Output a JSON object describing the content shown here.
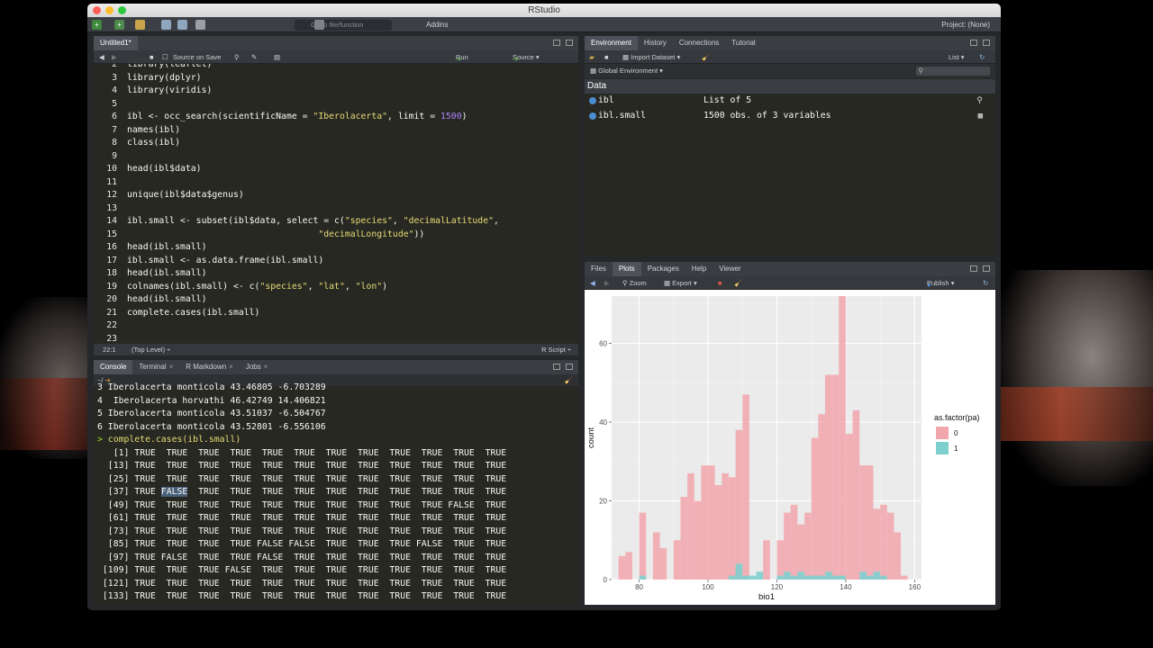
{
  "window": {
    "title": "RStudio"
  },
  "main_toolbar": {
    "goto_placeholder": "Go to file/function",
    "addins": "Addins",
    "project": "Project: (None)"
  },
  "editor": {
    "tab": "Untitled1*",
    "source_on_save": "Source on Save",
    "run": "Run",
    "source": "Source",
    "lines": [
      {
        "n": "2",
        "segs": [
          [
            "library(leaflet)",
            ""
          ]
        ]
      },
      {
        "n": "3",
        "segs": [
          [
            "library(dplyr)",
            ""
          ]
        ]
      },
      {
        "n": "4",
        "segs": [
          [
            "library(viridis)",
            ""
          ]
        ]
      },
      {
        "n": "5",
        "segs": []
      },
      {
        "n": "6",
        "segs": [
          [
            "ibl <- occ_search(scientificName = ",
            ""
          ],
          [
            "\"Iberolacerta\"",
            "s-str"
          ],
          [
            ", limit = ",
            ""
          ],
          [
            "1500",
            "s-num"
          ],
          [
            ")",
            ""
          ]
        ]
      },
      {
        "n": "7",
        "segs": [
          [
            "names(ibl)",
            ""
          ]
        ]
      },
      {
        "n": "8",
        "segs": [
          [
            "class(ibl)",
            ""
          ]
        ]
      },
      {
        "n": "9",
        "segs": []
      },
      {
        "n": "10",
        "segs": [
          [
            "head(ibl$data)",
            ""
          ]
        ]
      },
      {
        "n": "11",
        "segs": []
      },
      {
        "n": "12",
        "segs": [
          [
            "unique(ibl$data$genus)",
            ""
          ]
        ]
      },
      {
        "n": "13",
        "segs": []
      },
      {
        "n": "14",
        "segs": [
          [
            "ibl.small <- subset(ibl$data, select = c(",
            ""
          ],
          [
            "\"species\"",
            "s-str"
          ],
          [
            ", ",
            ""
          ],
          [
            "\"decimalLatitude\"",
            "s-str"
          ],
          [
            ",",
            ""
          ]
        ]
      },
      {
        "n": "15",
        "segs": [
          [
            "                                    ",
            ""
          ],
          [
            "\"decimalLongitude\"",
            "s-str"
          ],
          [
            "))",
            ""
          ]
        ]
      },
      {
        "n": "16",
        "segs": [
          [
            "head(ibl.small)",
            ""
          ]
        ]
      },
      {
        "n": "17",
        "segs": [
          [
            "ibl.small <- as.data.frame(ibl.small)",
            ""
          ]
        ]
      },
      {
        "n": "18",
        "segs": [
          [
            "head(ibl.small)",
            ""
          ]
        ]
      },
      {
        "n": "19",
        "segs": [
          [
            "colnames(ibl.small) <- c(",
            ""
          ],
          [
            "\"species\"",
            "s-str"
          ],
          [
            ", ",
            ""
          ],
          [
            "\"lat\"",
            "s-str"
          ],
          [
            ", ",
            ""
          ],
          [
            "\"lon\"",
            "s-str"
          ],
          [
            ")",
            ""
          ]
        ]
      },
      {
        "n": "20",
        "segs": [
          [
            "head(ibl.small)",
            ""
          ]
        ]
      },
      {
        "n": "21",
        "segs": [
          [
            "complete.cases(ibl.small)",
            ""
          ]
        ]
      },
      {
        "n": "22",
        "segs": []
      },
      {
        "n": "23",
        "segs": []
      }
    ],
    "status_pos": "22:1",
    "status_scope": "(Top Level) ÷",
    "status_type": "R Script ÷"
  },
  "console": {
    "tabs": [
      "Console",
      "Terminal",
      "R Markdown",
      "Jobs"
    ],
    "path": "~/",
    "head_rows": [
      "3 Iberolacerta monticola 43.46805 -6.703289",
      "4  Iberolacerta horvathi 46.42749 14.406821",
      "5 Iberolacerta monticola 43.51037 -6.504767",
      "6 Iberolacerta monticola 43.52801 -6.556106"
    ],
    "prompt": ">",
    "command": "complete.cases(ibl.small)",
    "result_rows": [
      [
        "[1]",
        "TRUE  TRUE  TRUE  TRUE  TRUE  TRUE  TRUE  TRUE  TRUE  TRUE  TRUE  TRUE"
      ],
      [
        "[13]",
        "TRUE  TRUE  TRUE  TRUE  TRUE  TRUE  TRUE  TRUE  TRUE  TRUE  TRUE  TRUE"
      ],
      [
        "[25]",
        "TRUE  TRUE  TRUE  TRUE  TRUE  TRUE  TRUE  TRUE  TRUE  TRUE  TRUE  TRUE"
      ],
      [
        "[37]",
        "TRUE FALSE  TRUE  TRUE  TRUE  TRUE  TRUE  TRUE  TRUE  TRUE  TRUE  TRUE"
      ],
      [
        "[49]",
        "TRUE  TRUE  TRUE  TRUE  TRUE  TRUE  TRUE  TRUE  TRUE  TRUE FALSE  TRUE"
      ],
      [
        "[61]",
        "TRUE  TRUE  TRUE  TRUE  TRUE  TRUE  TRUE  TRUE  TRUE  TRUE  TRUE  TRUE"
      ],
      [
        "[73]",
        "TRUE  TRUE  TRUE  TRUE  TRUE  TRUE  TRUE  TRUE  TRUE  TRUE  TRUE  TRUE"
      ],
      [
        "[85]",
        "TRUE  TRUE  TRUE  TRUE FALSE FALSE  TRUE  TRUE  TRUE FALSE  TRUE  TRUE"
      ],
      [
        "[97]",
        "TRUE FALSE  TRUE  TRUE FALSE  TRUE  TRUE  TRUE  TRUE  TRUE  TRUE  TRUE"
      ],
      [
        "[109]",
        "TRUE  TRUE  TRUE FALSE  TRUE  TRUE  TRUE  TRUE  TRUE  TRUE  TRUE  TRUE"
      ],
      [
        "[121]",
        "TRUE  TRUE  TRUE  TRUE  TRUE  TRUE  TRUE  TRUE  TRUE  TRUE  TRUE  TRUE"
      ],
      [
        "[133]",
        "TRUE  TRUE  TRUE  TRUE  TRUE  TRUE  TRUE  TRUE  TRUE  TRUE  TRUE  TRUE"
      ]
    ],
    "selected_text": "FALSE"
  },
  "environment": {
    "tabs": [
      "Environment",
      "History",
      "Connections",
      "Tutorial"
    ],
    "import_dataset": "Import Dataset",
    "list_view": "List",
    "scope": "Global Environment",
    "section": "Data",
    "rows": [
      {
        "name": "ibl",
        "value": "List of 5"
      },
      {
        "name": "ibl.small",
        "value": "1500 obs. of 3 variables"
      }
    ]
  },
  "plots_pane": {
    "tabs": [
      "Files",
      "Plots",
      "Packages",
      "Help",
      "Viewer"
    ],
    "zoom": "Zoom",
    "export": "Export",
    "publish": "Publish"
  },
  "colors": {
    "pa0": "#f1a6ad",
    "pa1": "#7fcfcf",
    "panel_bg": "#ebebeb"
  },
  "chart_data": {
    "type": "bar",
    "xlabel": "bio1",
    "ylabel": "count",
    "xlim": [
      72,
      162
    ],
    "ylim": [
      0,
      72
    ],
    "xticks": [
      80,
      100,
      120,
      140,
      160
    ],
    "yticks": [
      0,
      20,
      40,
      60
    ],
    "legend_title": "as.factor(pa)",
    "legend_position": "right",
    "bin_width": 2,
    "series": [
      {
        "name": "0",
        "x": [
          75,
          77,
          79,
          81,
          83,
          85,
          87,
          89,
          91,
          93,
          95,
          97,
          99,
          101,
          103,
          105,
          107,
          109,
          111,
          113,
          115,
          117,
          119,
          121,
          123,
          125,
          127,
          129,
          131,
          133,
          135,
          137,
          139,
          141,
          143,
          145,
          147,
          149,
          151,
          153,
          155,
          157
        ],
        "values": [
          6,
          7,
          0,
          17,
          0,
          12,
          8,
          0,
          10,
          21,
          27,
          20,
          29,
          29,
          24,
          27,
          26,
          38,
          47,
          0,
          0,
          10,
          0,
          10,
          17,
          19,
          14,
          17,
          36,
          42,
          52,
          52,
          72,
          37,
          43,
          29,
          29,
          18,
          19,
          17,
          12,
          1
        ],
        "color": "#f1a6ad"
      },
      {
        "name": "1",
        "x": [
          75,
          77,
          79,
          81,
          83,
          85,
          87,
          89,
          91,
          93,
          95,
          97,
          99,
          101,
          103,
          105,
          107,
          109,
          111,
          113,
          115,
          117,
          119,
          121,
          123,
          125,
          127,
          129,
          131,
          133,
          135,
          137,
          139,
          141,
          143,
          145,
          147,
          149,
          151,
          153,
          155,
          157
        ],
        "values": [
          0,
          0,
          0,
          1,
          0,
          0,
          0,
          0,
          0,
          0,
          0,
          0,
          0,
          0,
          0,
          0,
          1,
          4,
          1,
          1,
          2,
          0,
          0,
          1,
          2,
          1,
          2,
          1,
          1,
          1,
          2,
          1,
          1,
          0,
          0,
          2,
          1,
          2,
          1,
          0,
          0,
          0
        ],
        "color": "#7fcfcf"
      }
    ]
  }
}
